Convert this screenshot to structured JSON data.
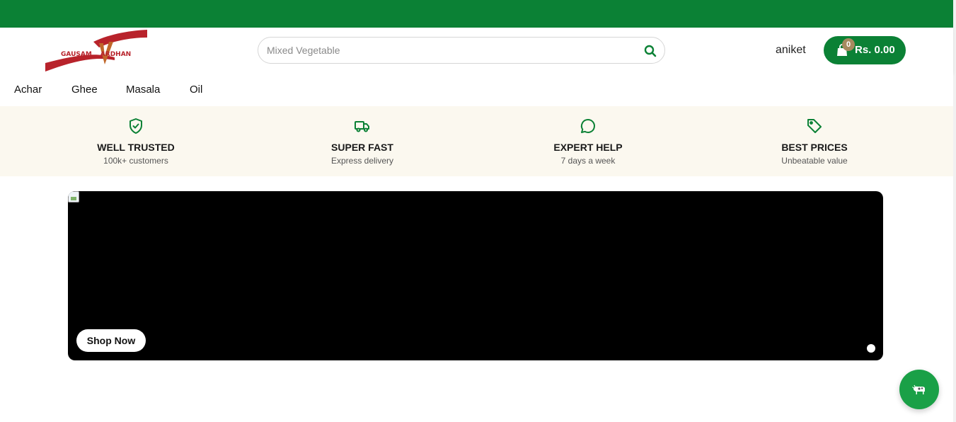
{
  "brand": {
    "logo_text_left": "GAUSAM",
    "logo_text_right": "ARDHAN",
    "primary_color": "#0b8135",
    "logo_color": "#b8232b"
  },
  "search": {
    "placeholder": "Mixed Vegetable",
    "value": ""
  },
  "user": {
    "name": "aniket"
  },
  "cart": {
    "count": "0",
    "total": "Rs. 0.00"
  },
  "categories": [
    {
      "label": "Achar"
    },
    {
      "label": "Ghee"
    },
    {
      "label": "Masala"
    },
    {
      "label": "Oil"
    }
  ],
  "features": [
    {
      "icon": "shield-check-icon",
      "title": "WELL TRUSTED",
      "subtitle": "100k+ customers"
    },
    {
      "icon": "truck-icon",
      "title": "SUPER FAST",
      "subtitle": "Express delivery"
    },
    {
      "icon": "chat-bubble-icon",
      "title": "EXPERT HELP",
      "subtitle": "7 days a week"
    },
    {
      "icon": "tag-icon",
      "title": "BEST PRICES",
      "subtitle": "Unbeatable value"
    }
  ],
  "banner": {
    "button_label": "Shop Now",
    "slide_count": 1,
    "active_slide": 1
  },
  "floating_button": {
    "icon": "cow-icon"
  }
}
